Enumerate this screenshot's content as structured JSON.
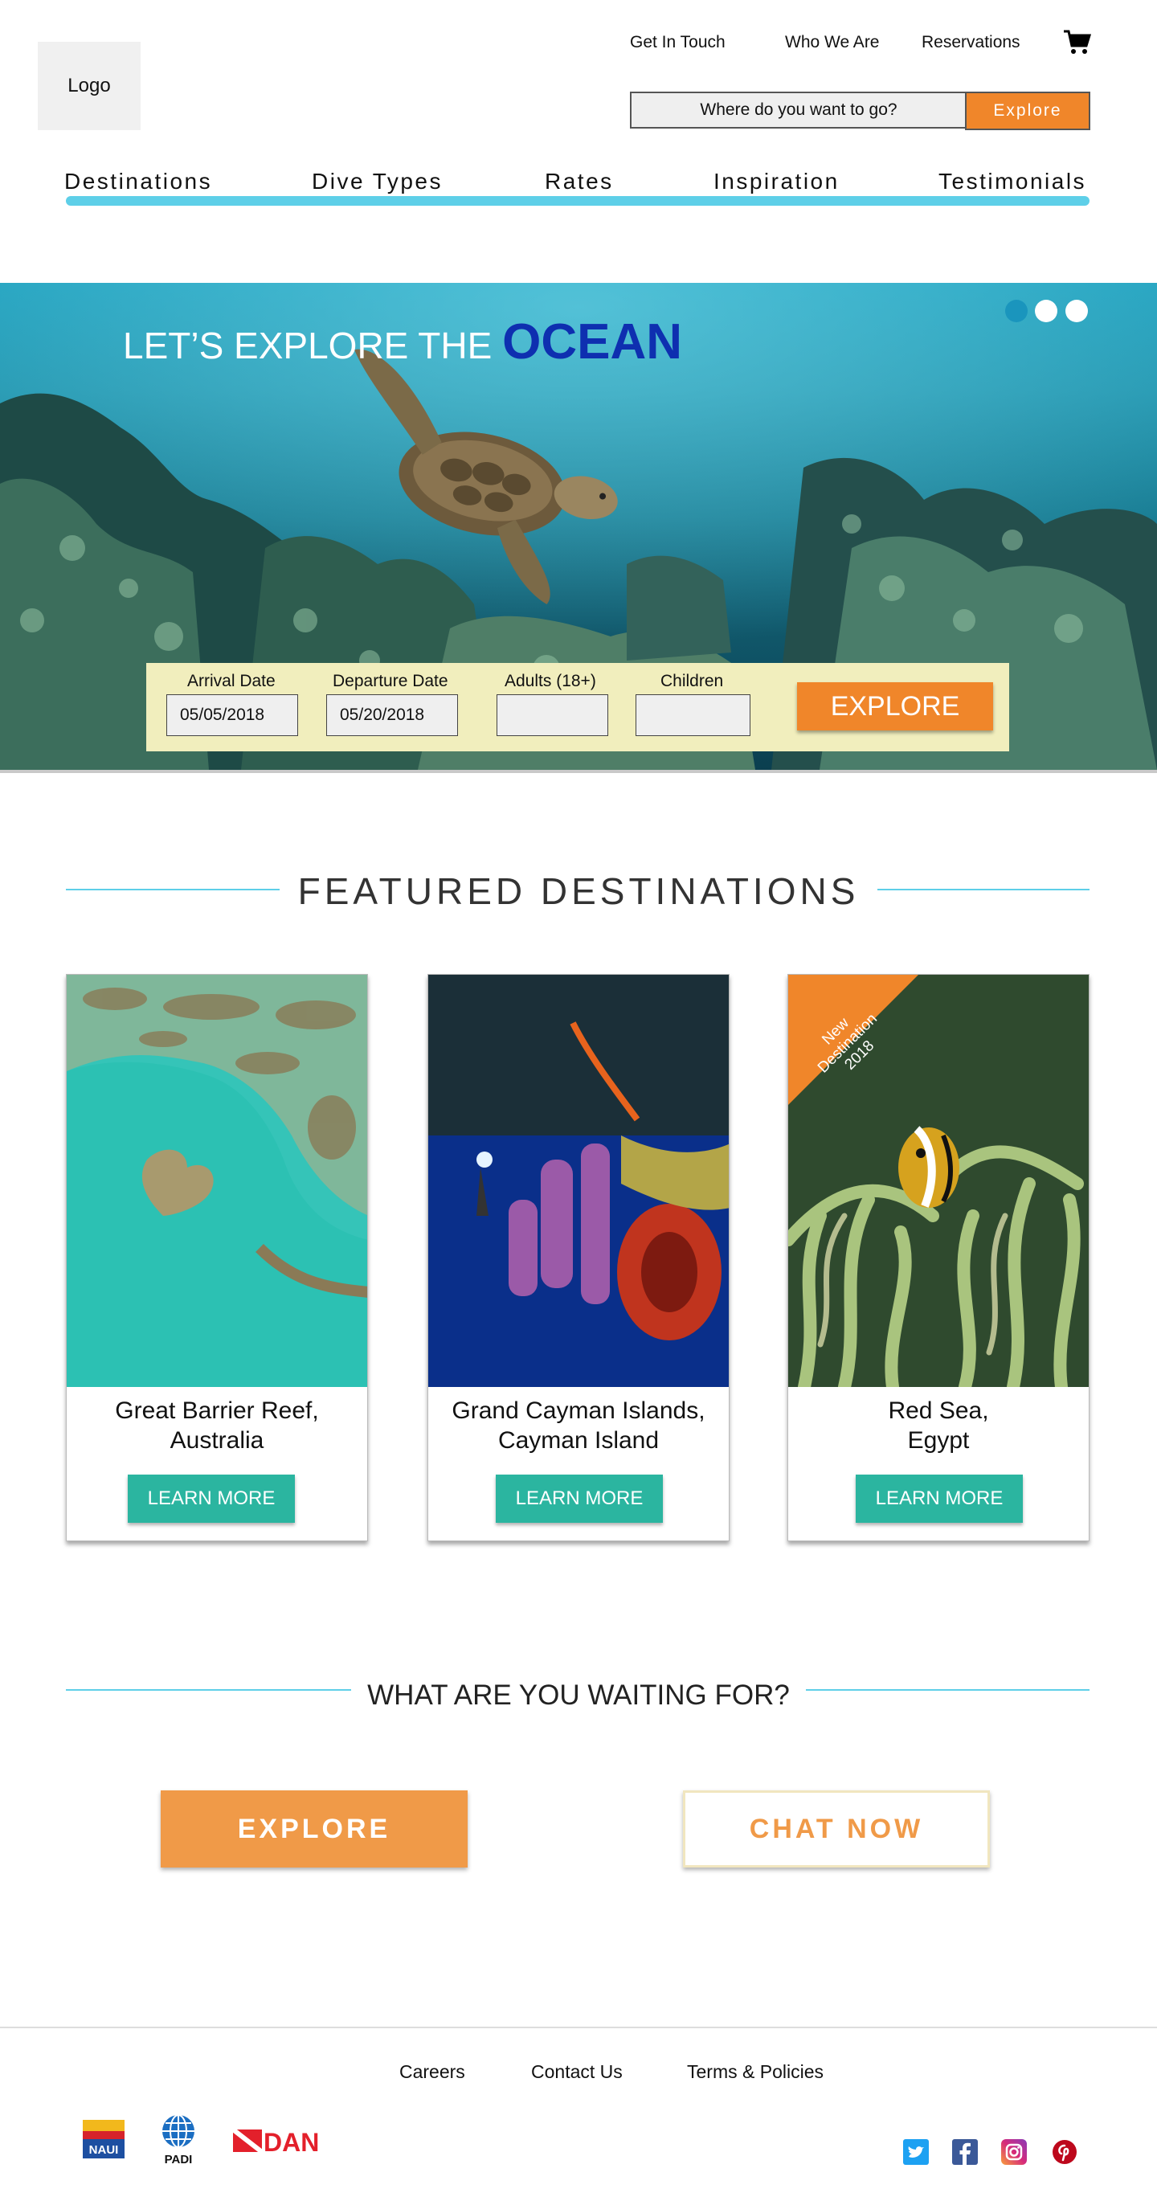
{
  "header": {
    "logo_label": "Logo",
    "links": [
      "Get In Touch",
      "Who We Are",
      "Reservations"
    ],
    "cart_icon": "cart-icon",
    "search_placeholder": "Where do you want to go?",
    "search_button": "Explore"
  },
  "nav": [
    "Destinations",
    "Dive Types",
    "Rates",
    "Inspiration",
    "Testimonials"
  ],
  "hero": {
    "caption_lead": "LET’S EXPLORE THE",
    "caption_emphasis": "OCEAN",
    "carousel_dots": 3,
    "booking": {
      "arrival_label": "Arrival Date",
      "arrival_value": "05/05/2018",
      "departure_label": "Departure Date",
      "departure_value": "05/20/2018",
      "adults_label": "Adults (18+)",
      "adults_value": "",
      "children_label": "Children",
      "children_value": "",
      "explore_button": "EXPLORE"
    }
  },
  "featured": {
    "title": "FEATURED DESTINATIONS",
    "cards": [
      {
        "title_line1": "Great Barrier Reef,",
        "title_line2": "Australia",
        "button": "LEARN MORE"
      },
      {
        "title_line1": "Grand Cayman Islands,",
        "title_line2": "Cayman Island",
        "button": "LEARN MORE"
      },
      {
        "title_line1": "Red Sea,",
        "title_line2": "Egypt",
        "button": "LEARN MORE",
        "ribbon_lines": [
          "New",
          "Destination",
          "2018"
        ]
      }
    ]
  },
  "cta": {
    "title": "WHAT ARE YOU WAITING FOR?",
    "explore_button": "EXPLORE",
    "chat_button": "CHAT NOW"
  },
  "footer": {
    "links": [
      "Careers",
      "Contact Us",
      "Terms & Policies"
    ],
    "partners": [
      "NAUI",
      "PADI",
      "DAN"
    ],
    "social_icons": [
      "twitter-icon",
      "facebook-icon",
      "instagram-icon",
      "pinterest-icon"
    ]
  },
  "colors": {
    "accent_orange": "#f0862a",
    "teal_button": "#2bb5a0",
    "nav_bar": "#5ecfe8",
    "ocean_blue": "#0e2fb0"
  }
}
